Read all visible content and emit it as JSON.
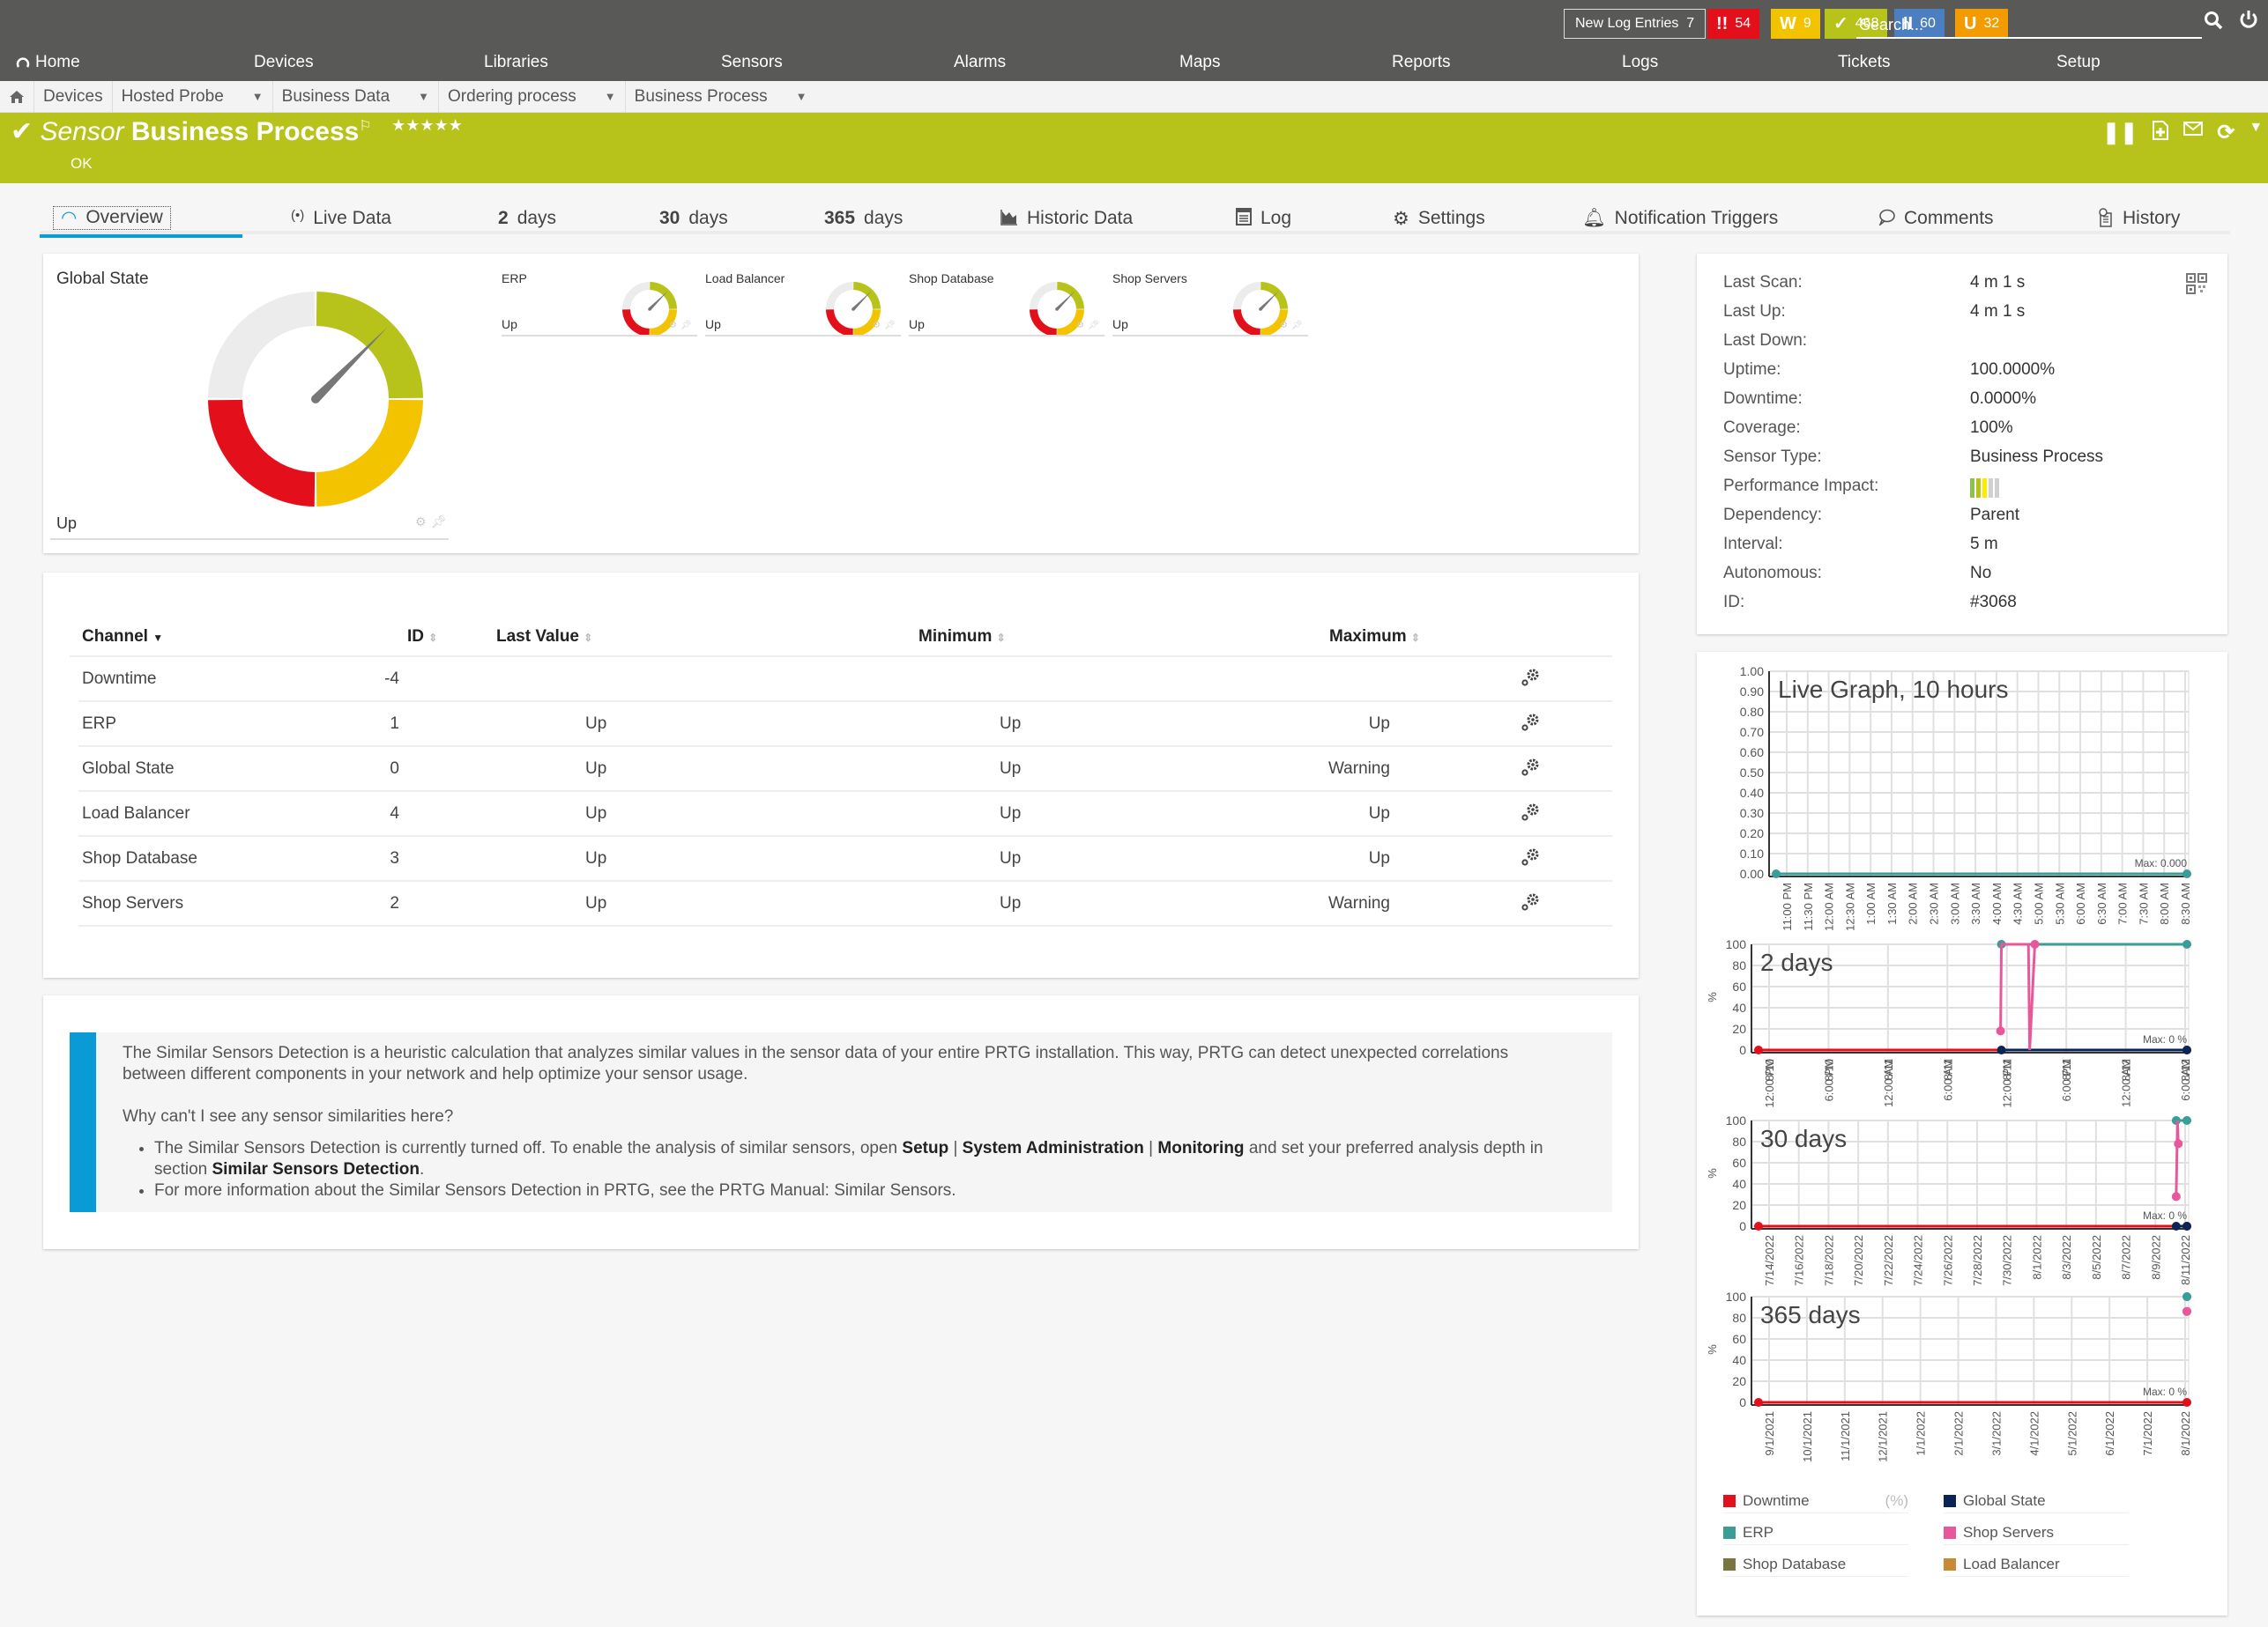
{
  "topbar": {
    "new_log_label": "New Log Entries",
    "new_log_count": "7",
    "badges": [
      {
        "icon": "!!",
        "count": "54",
        "color": "#e30f1b",
        "name": "down"
      },
      {
        "icon": "W",
        "count": "9",
        "color": "#f4c300",
        "name": "warning"
      },
      {
        "icon": "✓",
        "count": "468",
        "color": "#b7c31b",
        "name": "up"
      },
      {
        "icon": "II",
        "count": "60",
        "color": "#4c7fc1",
        "name": "paused"
      },
      {
        "icon": "U",
        "count": "32",
        "color": "#f39b00",
        "name": "unusual"
      }
    ],
    "search_placeholder": "Search...",
    "nav": [
      "Home",
      "Devices",
      "Libraries",
      "Sensors",
      "Alarms",
      "Maps",
      "Reports",
      "Logs",
      "Tickets",
      "Setup"
    ]
  },
  "breadcrumb": [
    "Devices",
    "Hosted Probe",
    "Business Data",
    "Ordering process",
    "Business Process"
  ],
  "sensor": {
    "prefix": "Sensor",
    "name": "Business Process",
    "status": "OK",
    "stars": "★★★★★"
  },
  "tabs": [
    {
      "label": "Overview",
      "icon": "gauge"
    },
    {
      "label": "Live Data",
      "icon": "broadcast"
    },
    {
      "num": "2",
      "label": "days"
    },
    {
      "num": "30",
      "label": "days"
    },
    {
      "num": "365",
      "label": "days"
    },
    {
      "label": "Historic Data",
      "icon": "area-chart"
    },
    {
      "label": "Log",
      "icon": "log"
    },
    {
      "label": "Settings",
      "icon": "gear"
    },
    {
      "label": "Notification Triggers",
      "icon": "bell"
    },
    {
      "label": "Comments",
      "icon": "comment"
    },
    {
      "label": "History",
      "icon": "history"
    }
  ],
  "gauges": {
    "main": {
      "title": "Global State",
      "value": "Up"
    },
    "mini": [
      {
        "title": "ERP",
        "value": "Up"
      },
      {
        "title": "Load Balancer",
        "value": "Up"
      },
      {
        "title": "Shop Database",
        "value": "Up"
      },
      {
        "title": "Shop Servers",
        "value": "Up"
      }
    ]
  },
  "channels": {
    "headers": {
      "channel": "Channel",
      "id": "ID",
      "last": "Last Value",
      "min": "Minimum",
      "max": "Maximum"
    },
    "rows": [
      {
        "channel": "Downtime",
        "id": "-4",
        "last": "",
        "min": "",
        "max": ""
      },
      {
        "channel": "ERP",
        "id": "1",
        "last": "Up",
        "min": "Up",
        "max": "Up"
      },
      {
        "channel": "Global State",
        "id": "0",
        "last": "Up",
        "min": "Up",
        "max": "Warning"
      },
      {
        "channel": "Load Balancer",
        "id": "4",
        "last": "Up",
        "min": "Up",
        "max": "Up"
      },
      {
        "channel": "Shop Database",
        "id": "3",
        "last": "Up",
        "min": "Up",
        "max": "Up"
      },
      {
        "channel": "Shop Servers",
        "id": "2",
        "last": "Up",
        "min": "Up",
        "max": "Warning"
      }
    ]
  },
  "similar": {
    "intro": "The Similar Sensors Detection is a heuristic calculation that analyzes similar values in the sensor data of your entire PRTG installation. This way, PRTG can detect unexpected correlations between different components in your network and help optimize your sensor usage.",
    "question": "Why can't I see any sensor similarities here?",
    "b1_a": "The Similar Sensors Detection is currently turned off. To enable the analysis of similar sensors, open ",
    "b1_setup": "Setup",
    "b1_sep": " | ",
    "b1_sysadmin": "System Administration",
    "b1_monitoring": "Monitoring",
    "b1_b": " and set your preferred analysis depth in section ",
    "b1_section": "Similar Sensors Detection",
    "b1_end": ".",
    "b2": "For more information about the Similar Sensors Detection in PRTG, see the PRTG Manual: Similar Sensors."
  },
  "info": [
    {
      "key": "Last Scan:",
      "value": "4 m 1 s"
    },
    {
      "key": "Last Up:",
      "value": "4 m 1 s"
    },
    {
      "key": "Last Down:",
      "value": ""
    },
    {
      "key": "Uptime:",
      "value": "100.0000%"
    },
    {
      "key": "Downtime:",
      "value": "0.0000%"
    },
    {
      "key": "Coverage:",
      "value": "100%"
    },
    {
      "key": "Sensor Type:",
      "value": "Business Process"
    },
    {
      "key": "Performance Impact:",
      "value": ""
    },
    {
      "key": "Dependency:",
      "value": "Parent"
    },
    {
      "key": "Interval:",
      "value": "5 m"
    },
    {
      "key": "Autonomous:",
      "value": "No"
    },
    {
      "key": "ID:",
      "value": "#3068"
    }
  ],
  "performance_impact_level": 3,
  "legend_unit": "(%)",
  "legend": [
    {
      "name": "Downtime",
      "color": "#e30f1b"
    },
    {
      "name": "Global State",
      "color": "#0c2356"
    },
    {
      "name": "ERP",
      "color": "#3a9d96"
    },
    {
      "name": "Shop Servers",
      "color": "#e8579a"
    },
    {
      "name": "Shop Database",
      "color": "#7a7540"
    },
    {
      "name": "Load Balancer",
      "color": "#c98a35"
    }
  ],
  "chart_data": [
    {
      "type": "line",
      "title": "Live Graph, 10 hours",
      "ylim": [
        0,
        1
      ],
      "yticks": [
        "0.00",
        "0.10",
        "0.20",
        "0.30",
        "0.40",
        "0.50",
        "0.60",
        "0.70",
        "0.80",
        "0.90",
        "1.00"
      ],
      "xticks": [
        "11:00 PM",
        "11:30 PM",
        "12:00 AM",
        "12:30 AM",
        "1:00 AM",
        "1:30 AM",
        "2:00 AM",
        "2:30 AM",
        "3:00 AM",
        "3:30 AM",
        "4:00 AM",
        "4:30 AM",
        "5:00 AM",
        "5:30 AM",
        "6:00 AM",
        "6:30 AM",
        "7:00 AM",
        "7:30 AM",
        "8:00 AM",
        "8:30 AM"
      ],
      "max_label": "Max: 0.000",
      "ylabel": "",
      "series": [
        {
          "name": "ERP",
          "color": "#3a9d96",
          "points": [
            [
              0,
              0
            ],
            [
              1,
              0
            ]
          ]
        }
      ]
    },
    {
      "type": "line",
      "title": "2 days",
      "ylim": [
        0,
        100
      ],
      "yticks": [
        "0",
        "20",
        "40",
        "60",
        "80",
        "100"
      ],
      "xticks": [
        "8/10 12:00 PM",
        "8/10 6:00 PM",
        "8/11 12:00 AM",
        "8/11 6:00 AM",
        "8/11 12:00 PM",
        "8/11 6:00 PM",
        "8/12 12:00 AM",
        "8/12 6:00 AM"
      ],
      "max_label": "Max: 0 %",
      "ylabel": "%",
      "series": [
        {
          "name": "Downtime",
          "color": "#e30f1b",
          "points": [
            [
              0,
              0
            ],
            [
              1,
              0
            ]
          ]
        },
        {
          "name": "ERP",
          "color": "#3a9d96",
          "points": [
            [
              0.567,
              100
            ],
            [
              1,
              100
            ]
          ]
        },
        {
          "name": "Global State",
          "color": "#0c2356",
          "points": [
            [
              0.567,
              0
            ],
            [
              1,
              0
            ]
          ]
        },
        {
          "name": "Shop Servers",
          "color": "#e8579a",
          "points": [
            [
              0.565,
              18
            ],
            [
              0.567,
              100
            ],
            [
              0.63,
              100
            ],
            [
              0.633,
              0
            ],
            [
              0.645,
              100
            ]
          ]
        }
      ]
    },
    {
      "type": "line",
      "title": "30 days",
      "ylim": [
        0,
        100
      ],
      "yticks": [
        "0",
        "20",
        "40",
        "60",
        "80",
        "100"
      ],
      "xticks": [
        "7/14/2022",
        "7/16/2022",
        "7/18/2022",
        "7/20/2022",
        "7/22/2022",
        "7/24/2022",
        "7/26/2022",
        "7/28/2022",
        "7/30/2022",
        "8/1/2022",
        "8/3/2022",
        "8/5/2022",
        "8/7/2022",
        "8/9/2022",
        "8/11/2022"
      ],
      "max_label": "Max: 0 %",
      "ylabel": "%",
      "series": [
        {
          "name": "Downtime",
          "color": "#e30f1b",
          "points": [
            [
              0,
              0
            ],
            [
              1,
              0
            ]
          ]
        },
        {
          "name": "ERP",
          "color": "#3a9d96",
          "points": [
            [
              0.975,
              100
            ],
            [
              1,
              100
            ]
          ]
        },
        {
          "name": "Global State",
          "color": "#0c2356",
          "points": [
            [
              0.975,
              0
            ],
            [
              1,
              0
            ]
          ]
        },
        {
          "name": "Shop Servers",
          "color": "#e8579a",
          "points": [
            [
              0.975,
              28
            ],
            [
              0.978,
              100
            ],
            [
              0.98,
              78
            ]
          ]
        }
      ]
    },
    {
      "type": "line",
      "title": "365 days",
      "ylim": [
        0,
        100
      ],
      "yticks": [
        "0",
        "20",
        "40",
        "60",
        "80",
        "100"
      ],
      "xticks": [
        "9/1/2021",
        "10/1/2021",
        "11/1/2021",
        "12/1/2021",
        "1/1/2022",
        "2/1/2022",
        "3/1/2022",
        "4/1/2022",
        "5/1/2022",
        "6/1/2022",
        "7/1/2022",
        "8/1/2022"
      ],
      "max_label": "Max: 0 %",
      "ylabel": "%",
      "series": [
        {
          "name": "Downtime",
          "color": "#e30f1b",
          "points": [
            [
              0,
              0
            ],
            [
              1,
              0
            ]
          ]
        },
        {
          "name": "ERP",
          "color": "#3a9d96",
          "points": [
            [
              1,
              100
            ]
          ]
        },
        {
          "name": "Shop Servers",
          "color": "#e8579a",
          "points": [
            [
              1,
              86
            ]
          ]
        }
      ]
    }
  ]
}
